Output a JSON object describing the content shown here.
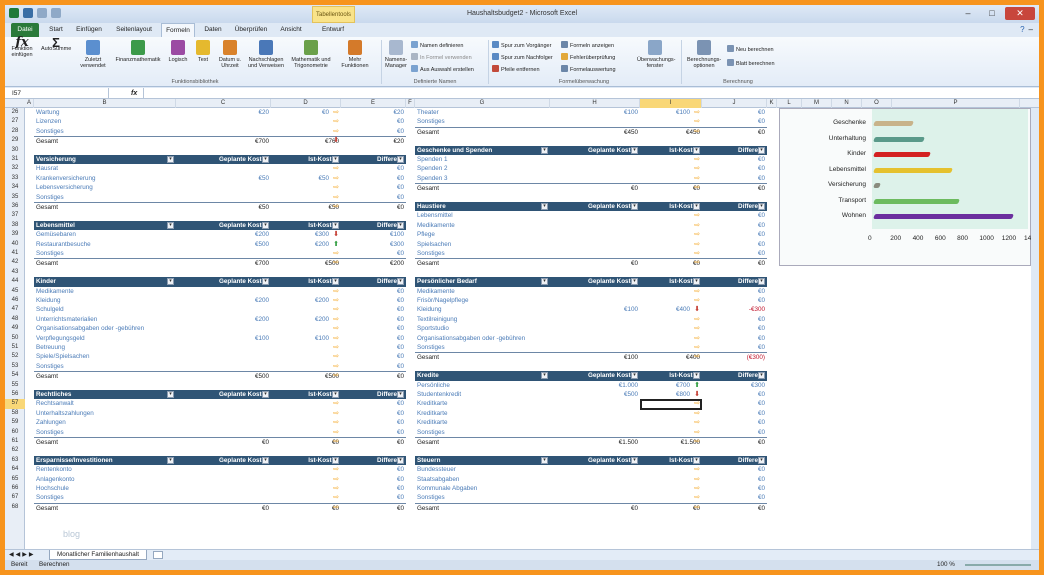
{
  "window": {
    "title": "Haushaltsbudget2 - Microsoft Excel",
    "context_tab": "Tabellentools",
    "minimize": "–",
    "maximize": "□",
    "close": "✕"
  },
  "tabs": [
    "Datei",
    "Start",
    "Einfügen",
    "Seitenlayout",
    "Formeln",
    "Daten",
    "Überprüfen",
    "Ansicht",
    "Entwurf"
  ],
  "ribbon": {
    "fx_label": "Funktion einfügen",
    "buttons": [
      "AutoSumme",
      "Zuletzt verwendet",
      "Finanzmathematik",
      "Logisch",
      "Text",
      "Datum u. Uhrzeit",
      "Nachschlagen und Verweisen",
      "Mathematik und Trigonometrie",
      "Mehr Funktionen",
      "Namens-Manager"
    ],
    "names_small": [
      "Namen definieren",
      "In Formel verwenden",
      "Aus Auswahl erstellen"
    ],
    "audit_small": [
      "Spur zum Vorgänger",
      "Spur zum Nachfolger",
      "Pfeile entfernen",
      "Formeln anzeigen",
      "Fehlerüberprüfung",
      "Formelauswertung"
    ],
    "watch": "Überwachungs-fenster",
    "calc_options": "Berechnungs-optionen",
    "calc_small": [
      "Neu berechnen",
      "Blatt berechnen"
    ],
    "groups": [
      "Funktionsbibliothek",
      "Definierte Namen",
      "Formelüberwachung",
      "Berechnung"
    ]
  },
  "formula_bar": {
    "name_box": "I57",
    "fx": "fx",
    "formula": ""
  },
  "columns": [
    "A",
    "B",
    "C",
    "D",
    "E",
    "F",
    "G",
    "H",
    "I",
    "J",
    "K",
    "L",
    "M",
    "N",
    "O",
    "P"
  ],
  "selected": {
    "column": "I",
    "row": "57"
  },
  "rows": [
    "26",
    "27",
    "28",
    "29",
    "30",
    "31",
    "32",
    "33",
    "34",
    "35",
    "36",
    "37",
    "38",
    "39",
    "40",
    "41",
    "42",
    "43",
    "44",
    "45",
    "46",
    "47",
    "48",
    "49",
    "50",
    "51",
    "52",
    "53",
    "54",
    "55",
    "56",
    "57",
    "58",
    "59",
    "60",
    "61",
    "62",
    "63",
    "64",
    "65",
    "66",
    "67",
    "68"
  ],
  "headers": {
    "planned": "Geplante Kosten",
    "actual": "Ist-Kosten",
    "diff": "Differenz",
    "total": "Gesamt"
  },
  "left_tables": [
    {
      "title": "",
      "start": 0,
      "items": [
        [
          "Wartung",
          "€20",
          "€0",
          "r",
          "€20"
        ],
        [
          "Lizenzen",
          "",
          "",
          "r",
          "€0"
        ],
        [
          "Sonstiges",
          "",
          "",
          "r",
          "€0"
        ]
      ],
      "total": [
        "€700",
        "€760",
        "d",
        "€20"
      ]
    },
    {
      "title": "Versicherung",
      "start": 5,
      "items": [
        [
          "Hausrat",
          "",
          "",
          "r",
          "€0"
        ],
        [
          "Krankenversicherung",
          "€50",
          "€50",
          "r",
          "€0"
        ],
        [
          "Lebensversicherung",
          "",
          "",
          "r",
          "€0"
        ],
        [
          "Sonstiges",
          "",
          "",
          "r",
          "€0"
        ]
      ],
      "total": [
        "€50",
        "€50",
        "r",
        "€0"
      ]
    },
    {
      "title": "Lebensmittel",
      "start": 12,
      "items": [
        [
          "Gemüsebaren",
          "€200",
          "€300",
          "d",
          "€100"
        ],
        [
          "Restaurantbesuche",
          "€500",
          "€200",
          "u",
          "€300"
        ],
        [
          "Sonstiges",
          "",
          "",
          "r",
          "€0"
        ]
      ],
      "total": [
        "€700",
        "€500",
        "r",
        "€200"
      ]
    },
    {
      "title": "Kinder",
      "start": 18,
      "items": [
        [
          "Medikamente",
          "",
          "",
          "r",
          "€0"
        ],
        [
          "Kleidung",
          "€200",
          "€200",
          "r",
          "€0"
        ],
        [
          "Schulgeld",
          "",
          "",
          "r",
          "€0"
        ],
        [
          "Unterrichtsmaterialien",
          "€200",
          "€200",
          "r",
          "€0"
        ],
        [
          "Organisationsabgaben oder -gebühren",
          "",
          "",
          "r",
          "€0"
        ],
        [
          "Verpflegungsgeld",
          "€100",
          "€100",
          "r",
          "€0"
        ],
        [
          "Betreuung",
          "",
          "",
          "r",
          "€0"
        ],
        [
          "Spiele/Spielsachen",
          "",
          "",
          "r",
          "€0"
        ],
        [
          "Sonstiges",
          "",
          "",
          "r",
          "€0"
        ]
      ],
      "total": [
        "€500",
        "€500",
        "r",
        "€0"
      ]
    },
    {
      "title": "Rechtliches",
      "start": 30,
      "items": [
        [
          "Rechtsanwalt",
          "",
          "",
          "r",
          "€0"
        ],
        [
          "Unterhaltszahlungen",
          "",
          "",
          "r",
          "€0"
        ],
        [
          "Zahlungen",
          "",
          "",
          "r",
          "€0"
        ],
        [
          "Sonstiges",
          "",
          "",
          "r",
          "€0"
        ]
      ],
      "total": [
        "€0",
        "€0",
        "r",
        "€0"
      ]
    },
    {
      "title": "Ersparnisse/Investitionen",
      "start": 37,
      "items": [
        [
          "Rentenkonto",
          "",
          "",
          "r",
          "€0"
        ],
        [
          "Anlagenkonto",
          "",
          "",
          "r",
          "€0"
        ],
        [
          "Hochschule",
          "",
          "",
          "r",
          "€0"
        ],
        [
          "Sonstiges",
          "",
          "",
          "r",
          "€0"
        ]
      ],
      "total": [
        "€0",
        "€0",
        "r",
        "€0"
      ]
    }
  ],
  "right_tables": [
    {
      "title": "",
      "start": 0,
      "items": [
        [
          "Theater",
          "€100",
          "€100",
          "r",
          "€0"
        ],
        [
          "Sonstiges",
          "",
          "",
          "r",
          "€0"
        ]
      ],
      "total": [
        "€450",
        "€450",
        "r",
        "€0"
      ]
    },
    {
      "title": "Geschenke und Spenden",
      "start": 4,
      "items": [
        [
          "Spenden 1",
          "",
          "",
          "r",
          "€0"
        ],
        [
          "Spenden 2",
          "",
          "",
          "r",
          "€0"
        ],
        [
          "Spenden 3",
          "",
          "",
          "r",
          "€0"
        ]
      ],
      "total": [
        "€0",
        "€0",
        "r",
        "€0"
      ]
    },
    {
      "title": "Haustiere",
      "start": 10,
      "items": [
        [
          "Lebensmittel",
          "",
          "",
          "r",
          "€0"
        ],
        [
          "Medikamente",
          "",
          "",
          "r",
          "€0"
        ],
        [
          "Pflege",
          "",
          "",
          "r",
          "€0"
        ],
        [
          "Spielsachen",
          "",
          "",
          "r",
          "€0"
        ],
        [
          "Sonstiges",
          "",
          "",
          "r",
          "€0"
        ]
      ],
      "total": [
        "€0",
        "€0",
        "r",
        "€0"
      ]
    },
    {
      "title": "Persönlicher Bedarf",
      "start": 18,
      "items": [
        [
          "Medikamente",
          "",
          "",
          "r",
          "€0"
        ],
        [
          "Frisör/Nagelpflege",
          "",
          "",
          "r",
          "€0"
        ],
        [
          "Kleidung",
          "€100",
          "€400",
          "d",
          "-€300"
        ],
        [
          "Textilreinigung",
          "",
          "",
          "r",
          "€0"
        ],
        [
          "Sportstudio",
          "",
          "",
          "r",
          "€0"
        ],
        [
          "Organisationsabgaben oder -gebühren",
          "",
          "",
          "r",
          "€0"
        ],
        [
          "Sonstiges",
          "",
          "",
          "r",
          "€0"
        ]
      ],
      "total": [
        "€100",
        "€400",
        "r",
        "(€300)"
      ]
    },
    {
      "title": "Kredite",
      "start": 28,
      "items": [
        [
          "Persönliche",
          "€1.000",
          "€700",
          "u",
          "€300"
        ],
        [
          "Studentenkredit",
          "€500",
          "€800",
          "d",
          "€0"
        ],
        [
          "Kreditkarte",
          "",
          "",
          "r",
          "€0"
        ],
        [
          "Kreditkarte",
          "",
          "",
          "r",
          "€0"
        ],
        [
          "Kreditkarte",
          "",
          "",
          "r",
          "€0"
        ],
        [
          "Sonstiges",
          "",
          "",
          "r",
          "€0"
        ]
      ],
      "total": [
        "€1.500",
        "€1.500",
        "r",
        "€0"
      ]
    },
    {
      "title": "Steuern",
      "start": 37,
      "items": [
        [
          "Bundessteuer",
          "",
          "",
          "r",
          "€0"
        ],
        [
          "Staatsabgaben",
          "",
          "",
          "r",
          "€0"
        ],
        [
          "Kommunale Abgaben",
          "",
          "",
          "r",
          "€0"
        ],
        [
          "Sonstiges",
          "",
          "",
          "r",
          "€0"
        ]
      ],
      "total": [
        "€0",
        "€0",
        "r",
        "€0"
      ]
    }
  ],
  "chart_data": {
    "type": "bar",
    "categories": [
      "Geschenke",
      "Unterhaltung",
      "Kinder",
      "Lebensmittel",
      "Versicherung",
      "Transport",
      "Wohnen"
    ],
    "values": [
      350,
      450,
      500,
      700,
      50,
      760,
      1250
    ],
    "colors": [
      "#c8b38a",
      "#5a9a8a",
      "#d32121",
      "#e5c12e",
      "#8a8c7e",
      "#6cbb5f",
      "#6b2f9e"
    ],
    "xticks": [
      "0",
      "200",
      "400",
      "600",
      "800",
      "1000",
      "1200",
      "1400"
    ],
    "xlim": [
      0,
      1400
    ]
  },
  "sheet_tab": "Monatlicher Familienhaushalt",
  "status": {
    "ready": "Bereit",
    "calc": "Berechnen",
    "zoom": "100 %"
  },
  "watermark": "blog"
}
